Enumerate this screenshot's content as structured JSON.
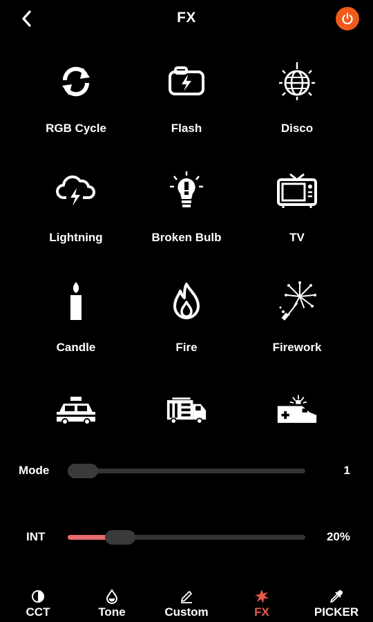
{
  "header": {
    "title": "FX"
  },
  "effects": [
    {
      "label": "RGB Cycle",
      "icon": "rgb-cycle-icon"
    },
    {
      "label": "Flash",
      "icon": "flash-icon"
    },
    {
      "label": "Disco",
      "icon": "disco-ball-icon"
    },
    {
      "label": "Lightning",
      "icon": "lightning-cloud-icon"
    },
    {
      "label": "Broken Bulb",
      "icon": "broken-bulb-icon"
    },
    {
      "label": "TV",
      "icon": "tv-icon"
    },
    {
      "label": "Candle",
      "icon": "candle-icon"
    },
    {
      "label": "Fire",
      "icon": "fire-icon"
    },
    {
      "label": "Firework",
      "icon": "firework-icon"
    },
    {
      "label": "",
      "icon": "police-car-icon"
    },
    {
      "label": "",
      "icon": "fire-truck-icon"
    },
    {
      "label": "",
      "icon": "ambulance-icon"
    }
  ],
  "sliders": {
    "mode": {
      "label": "Mode",
      "value": "1",
      "fraction": 0.0
    },
    "int": {
      "label": "INT",
      "value": "20%",
      "fraction": 0.2
    }
  },
  "tabs": [
    {
      "label": "CCT",
      "icon": "cct-icon"
    },
    {
      "label": "Tone",
      "icon": "droplet-icon"
    },
    {
      "label": "Custom",
      "icon": "pencil-icon"
    },
    {
      "label": "FX",
      "icon": "fx-icon",
      "active": true
    },
    {
      "label": "PICKER",
      "icon": "eyedropper-icon"
    }
  ],
  "colors": {
    "accent": "#e8584f",
    "power": "#f05a1a",
    "background": "#000000",
    "track": "#333333",
    "int_fill": "#e86a6a"
  }
}
